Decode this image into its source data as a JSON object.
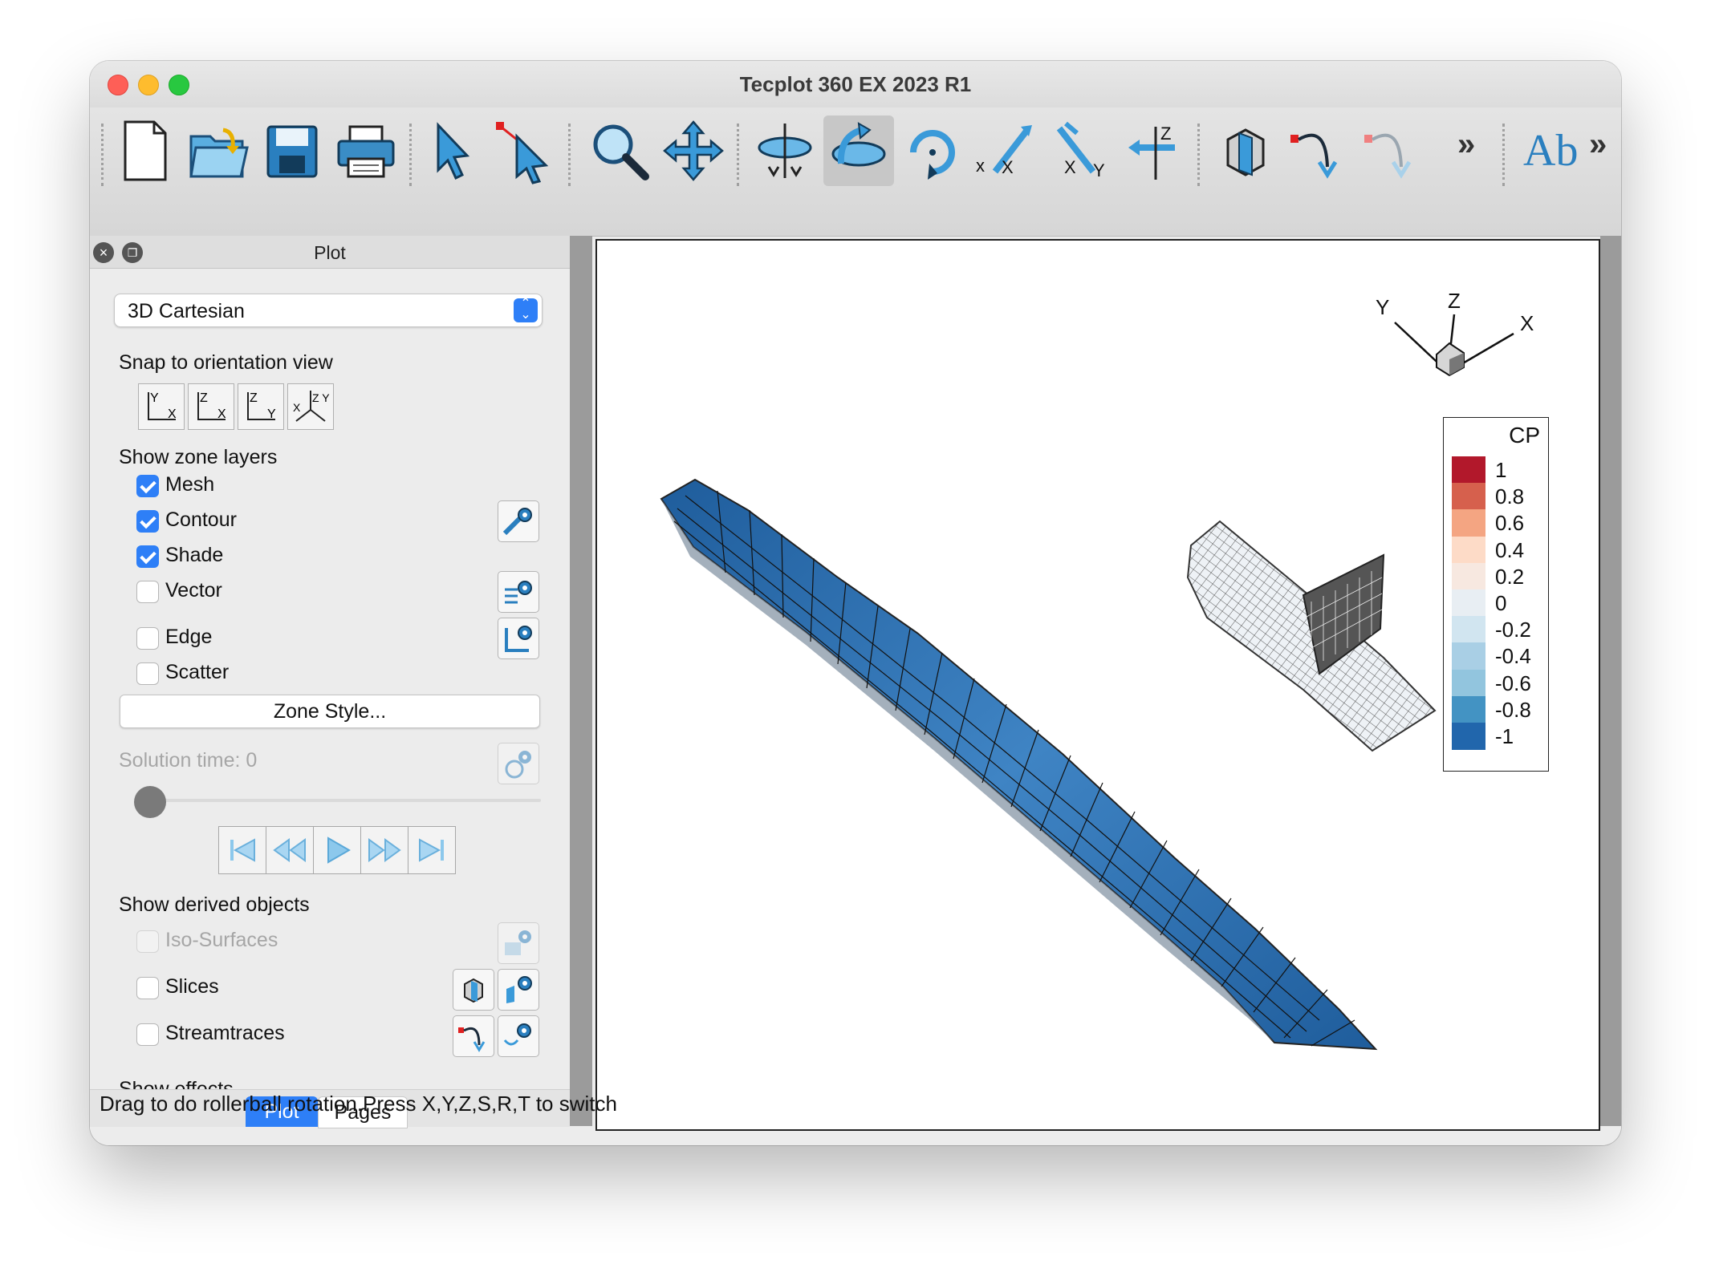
{
  "window": {
    "title": "Tecplot 360 EX 2023 R1"
  },
  "toolbar": {
    "buttons": [
      "new-file",
      "open-file",
      "save-file",
      "print",
      "select",
      "adjust",
      "zoom",
      "translate",
      "spherical-rotate",
      "rollerball-rotate",
      "twist-rotate",
      "rotate-x",
      "rotate-y",
      "rotate-z",
      "slice",
      "streamtrace-add",
      "streamtrace-delete",
      "more",
      "text",
      "more"
    ],
    "overflow_label": "»",
    "text_tool_label": "Ab"
  },
  "panel": {
    "title": "Plot",
    "plot_type": "3D Cartesian",
    "snap_heading": "Snap to orientation view",
    "snap_views": [
      {
        "v": "Y",
        "h": "X"
      },
      {
        "v": "Z",
        "h": "X"
      },
      {
        "v": "Z",
        "h": "Y"
      },
      {
        "v": "Z Y",
        "h": "X"
      }
    ],
    "zone_layers_heading": "Show zone layers",
    "layers": [
      {
        "label": "Mesh",
        "checked": true
      },
      {
        "label": "Contour",
        "checked": true
      },
      {
        "label": "Shade",
        "checked": true
      },
      {
        "label": "Vector",
        "checked": false
      },
      {
        "label": "Edge",
        "checked": false
      },
      {
        "label": "Scatter",
        "checked": false
      }
    ],
    "zone_style_button": "Zone Style...",
    "solution_time_label": "Solution time: 0",
    "derived_heading": "Show derived objects",
    "derived": [
      {
        "label": "Iso-Surfaces",
        "checked": false,
        "enabled": false
      },
      {
        "label": "Slices",
        "checked": false,
        "enabled": true
      },
      {
        "label": "Streamtraces",
        "checked": false,
        "enabled": true
      }
    ],
    "effects_heading": "Show effects",
    "tabs": [
      {
        "label": "Plot",
        "active": true
      },
      {
        "label": "Pages",
        "active": false
      }
    ]
  },
  "plot": {
    "axis_labels": {
      "x": "X",
      "y": "Y",
      "z": "Z"
    },
    "legend": {
      "title": "CP",
      "levels": [
        "1",
        "0.8",
        "0.6",
        "0.4",
        "0.2",
        "0",
        "-0.2",
        "-0.4",
        "-0.6",
        "-0.8",
        "-1"
      ],
      "colors": [
        "#b2182b",
        "#d6604d",
        "#f4a582",
        "#fddbc7",
        "#f7e8e0",
        "#e8eef3",
        "#d1e5f0",
        "#a9cfe5",
        "#92c5de",
        "#4393c3",
        "#2166ac"
      ]
    }
  },
  "status": {
    "text": "Drag to do rollerball rotation.Press X,Y,Z,S,R,T to switch"
  },
  "colors": {
    "accent": "#2e7ff7",
    "body_blue": "#2c6fb0"
  }
}
